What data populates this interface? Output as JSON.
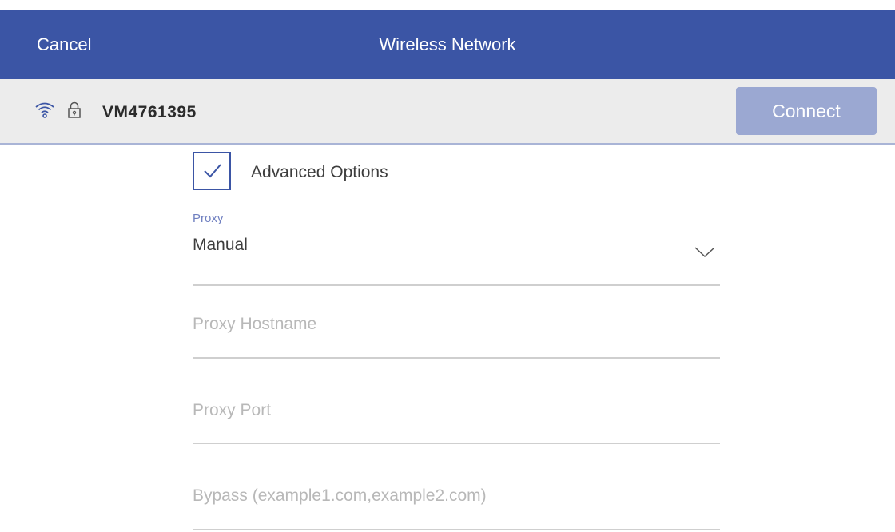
{
  "header": {
    "cancel_label": "Cancel",
    "title": "Wireless Network"
  },
  "network": {
    "signal_icon": "wifi-icon",
    "lock_icon": "lock-icon",
    "ssid": "VM4761395",
    "connect_label": "Connect"
  },
  "advanced": {
    "checked": true,
    "label": "Advanced Options"
  },
  "proxy": {
    "label": "Proxy",
    "value": "Manual",
    "icon": "chevron-down-icon"
  },
  "fields": {
    "hostname_placeholder": "Proxy Hostname",
    "port_placeholder": "Proxy Port",
    "bypass_placeholder": "Bypass (example1.com,example2.com)"
  },
  "colors": {
    "primary": "#3b55a5",
    "button_disabled": "#9ba8d2",
    "bar_background": "#ececec"
  }
}
